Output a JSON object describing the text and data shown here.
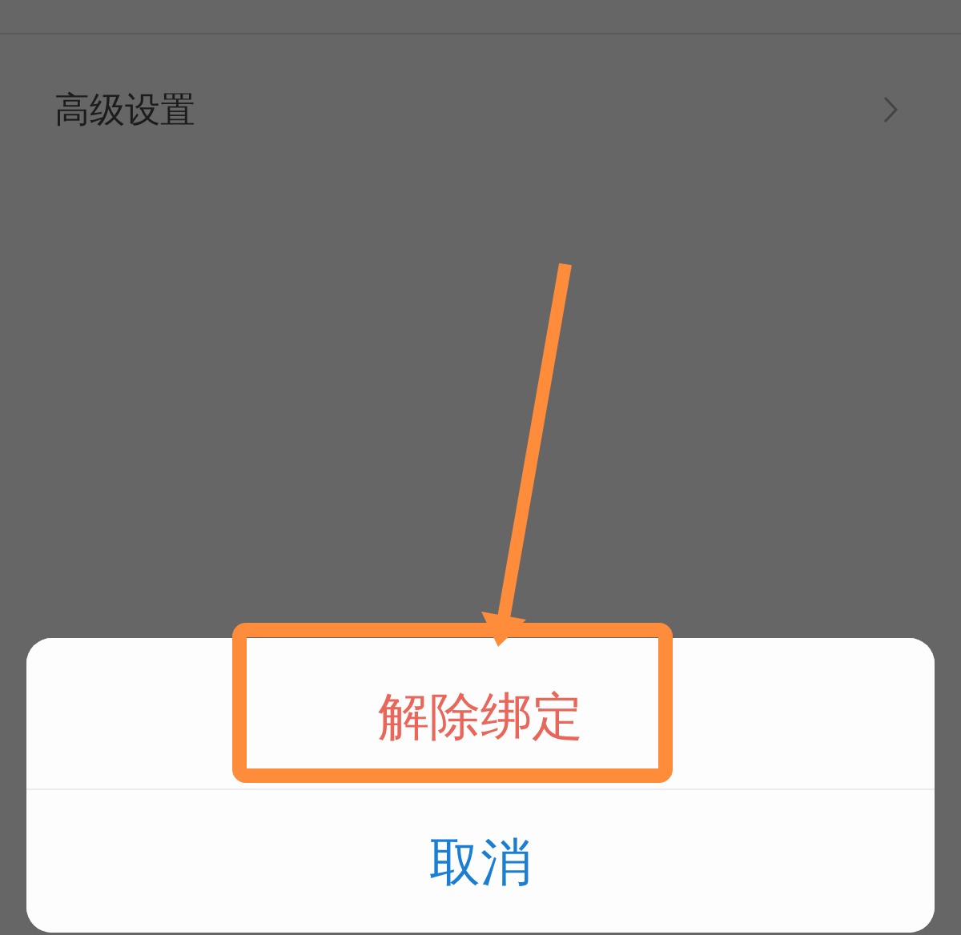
{
  "settings_row": {
    "label": "高级设置"
  },
  "action_sheet": {
    "options": [
      {
        "label": "解除绑定",
        "kind": "destructive"
      },
      {
        "label": "取消",
        "kind": "cancel"
      }
    ]
  }
}
